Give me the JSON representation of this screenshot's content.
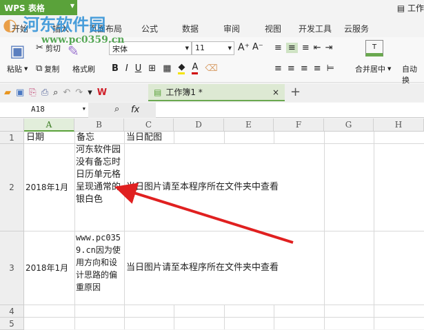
{
  "app": {
    "name": "WPS 表格",
    "doc_title": "工作"
  },
  "watermark": {
    "name": "河东软件园",
    "url": "www.pc0359.cn"
  },
  "tabs": [
    "开始",
    "插入",
    "页面布局",
    "公式",
    "数据",
    "审阅",
    "视图",
    "开发工具",
    "云服务"
  ],
  "ribbon": {
    "paste": "粘贴",
    "cut": "剪切",
    "copy": "复制",
    "format_painter": "格式刷",
    "font": "宋体",
    "size": "11",
    "merge": "合并居中",
    "autowrap": "自动换"
  },
  "doc_tab": {
    "label": "工作簿1 *",
    "close": "×",
    "new": "+"
  },
  "formula": {
    "name_box": "A18",
    "fx": "fx",
    "value": ""
  },
  "columns": [
    "A",
    "B",
    "C",
    "D",
    "E",
    "F",
    "G",
    "H"
  ],
  "rows": [
    "1",
    "2",
    "3",
    "4",
    "5"
  ],
  "cells": {
    "A1": "日期",
    "B1": "备忘",
    "C1": "当日配图",
    "A2": "2018年1月",
    "B2": "河东软件园没有备忘时日历单元格呈现通常的银白色",
    "C2": "当日图片请至本程序所在文件夹中查看",
    "A3": "2018年1月",
    "B3": "www.pc0359.cn因为使用方向和设计思路的偏重原因",
    "C3": "当日图片请至本程序所在文件夹中查看"
  },
  "colors": {
    "accent": "#5aa23a",
    "arrow": "#e02020"
  }
}
